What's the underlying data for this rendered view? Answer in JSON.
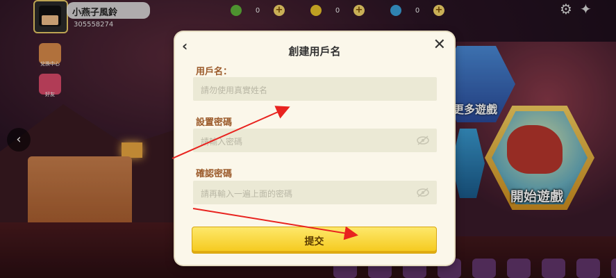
{
  "player": {
    "name": "小燕子風鈴",
    "id": "305558274"
  },
  "currencies": [
    {
      "name": "mini-bean",
      "value": "0",
      "color": "#5fb33a"
    },
    {
      "name": "mini-coin",
      "value": "0",
      "color": "#e8c32a"
    },
    {
      "name": "star",
      "value": "0",
      "color": "#3aa0d8"
    }
  ],
  "side_menu": {
    "exchange_center": "兌換中心",
    "friends": "好友"
  },
  "tiles": {
    "more_games": "更多遊戲",
    "start_game": "開始遊戲"
  },
  "dialog": {
    "title": "創建用戶名",
    "username_label": "用戶名：",
    "username_placeholder": "請勿使用真實姓名",
    "password_label": "設置密碼",
    "password_placeholder": "請輸入密碼",
    "confirm_label": "確認密碼",
    "confirm_placeholder": "請再輸入一遍上面的密碼",
    "submit_label": "提交"
  },
  "colors": {
    "accent_yellow": "#f5c81a",
    "arrow_red": "#e8231f",
    "label_brown": "#9b5a2a"
  }
}
